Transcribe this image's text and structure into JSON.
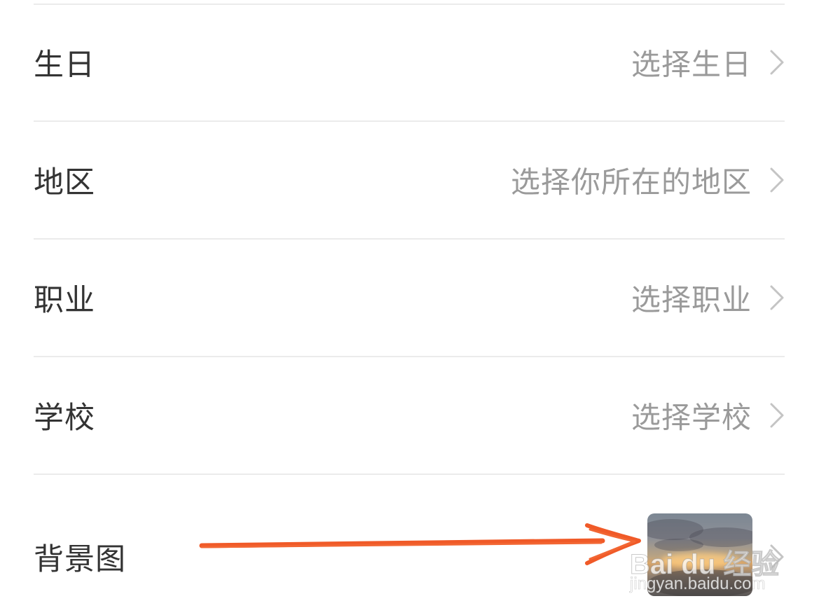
{
  "settings": {
    "rows": [
      {
        "label": "生日",
        "value": "选择生日"
      },
      {
        "label": "地区",
        "value": "选择你所在的地区"
      },
      {
        "label": "职业",
        "value": "选择职业"
      },
      {
        "label": "学校",
        "value": "选择学校"
      },
      {
        "label": "背景图",
        "value": ""
      }
    ],
    "chevron_icon": "chevron-right-icon",
    "background_thumbnail": "sunset-cloud-image"
  },
  "annotation": {
    "arrow_color": "#f05a28",
    "arrow_target": "background-image-thumbnail"
  },
  "watermark": {
    "brand": "Bai du 经验",
    "site": "jingyan.baidu.com"
  },
  "colors": {
    "label_text": "#333333",
    "value_text": "#9a9a9a",
    "divider": "#ebebeb",
    "chevron": "#c4c4c4",
    "background": "#ffffff"
  }
}
